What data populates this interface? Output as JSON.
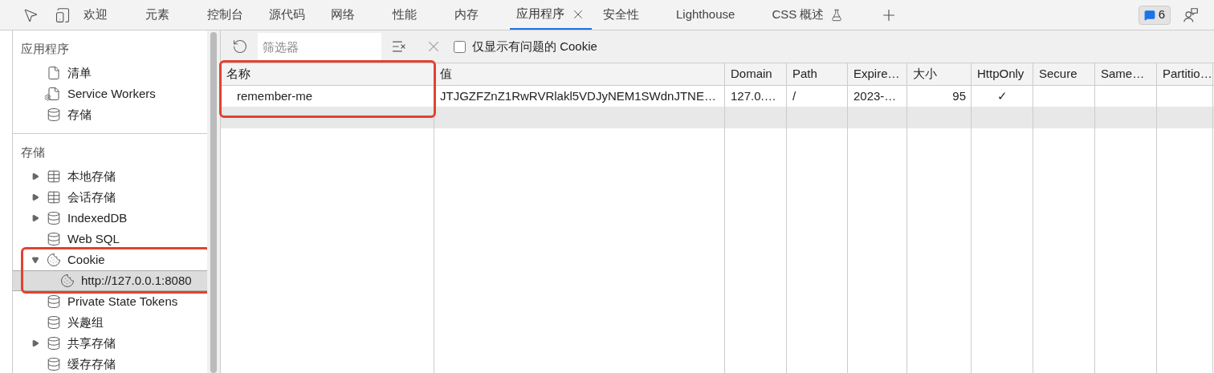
{
  "tabs": [
    {
      "label": "欢迎",
      "selected": false
    },
    {
      "label": "元素",
      "selected": false
    },
    {
      "label": "控制台",
      "selected": false
    },
    {
      "label": "源代码",
      "selected": false
    },
    {
      "label": "网络",
      "selected": false
    },
    {
      "label": "性能",
      "selected": false
    },
    {
      "label": "内存",
      "selected": false
    },
    {
      "label": "应用程序",
      "selected": true
    },
    {
      "label": "安全性",
      "selected": false
    },
    {
      "label": "Lighthouse",
      "selected": false
    },
    {
      "label": "CSS 概述",
      "selected": false,
      "experimental": true
    }
  ],
  "issues_badge": "6",
  "sidebar": [
    {
      "title": "应用程序",
      "items": [
        {
          "label": "清单",
          "kind": "document",
          "selected": false
        },
        {
          "label": "Service Workers",
          "kind": "service-worker",
          "selected": false
        },
        {
          "label": "存储",
          "kind": "database",
          "selected": false
        }
      ]
    },
    {
      "title": "存储",
      "items": [
        {
          "label": "本地存储",
          "kind": "table",
          "expanded": false,
          "selected": false
        },
        {
          "label": "会话存储",
          "kind": "table",
          "expanded": false,
          "selected": false
        },
        {
          "label": "IndexedDB",
          "kind": "database",
          "expanded": false,
          "selected": false
        },
        {
          "label": "Web SQL",
          "kind": "database",
          "selected": false
        },
        {
          "label": "Cookie",
          "kind": "cookie",
          "expanded": true,
          "selected": false,
          "highlighted": true,
          "children": [
            {
              "label": "http://127.0.0.1:8080",
              "kind": "cookie",
              "selected": true
            }
          ]
        },
        {
          "label": "Private State Tokens",
          "kind": "database",
          "selected": false
        },
        {
          "label": "兴趣组",
          "kind": "database",
          "selected": false
        },
        {
          "label": "共享存储",
          "kind": "database",
          "expanded": false,
          "selected": false
        },
        {
          "label": "缓存存储",
          "kind": "database",
          "selected": false
        }
      ]
    }
  ],
  "toolbar": {
    "filter_placeholder": "筛选器",
    "only_issues": {
      "label": "仅显示有问题的 Cookie",
      "checked": false
    }
  },
  "table": {
    "columns": [
      {
        "label": "名称",
        "highlighted": true
      },
      {
        "label": "值",
        "highlighted": false
      },
      {
        "label": "Domain",
        "highlighted": false
      },
      {
        "label": "Path",
        "highlighted": false
      },
      {
        "label": "Expire…",
        "highlighted": false
      },
      {
        "label": "大小",
        "highlighted": false
      },
      {
        "label": "HttpOnly",
        "highlighted": false
      },
      {
        "label": "Secure",
        "highlighted": false
      },
      {
        "label": "Same…",
        "highlighted": false
      },
      {
        "label": "Partitio…",
        "highlighted": false
      }
    ],
    "rows": [
      {
        "cells": [
          "remember-me",
          "JTJGZFZnZ1RwRVRlakl5VDJyNEM1SWdnJTNE…",
          "127.0.…",
          "/",
          "2023-…",
          "95",
          "✓",
          "",
          "",
          ""
        ]
      }
    ]
  }
}
